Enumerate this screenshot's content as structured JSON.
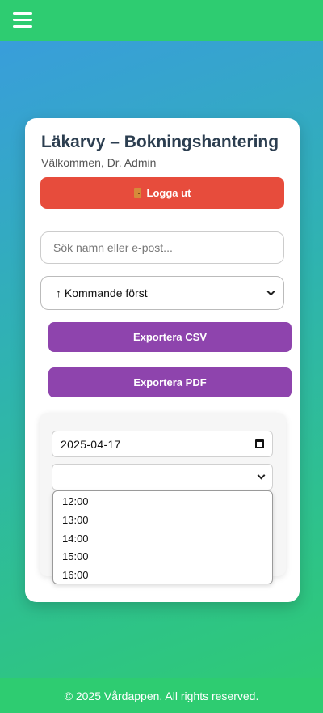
{
  "header": {
    "menu_icon": "hamburger-menu-icon"
  },
  "card": {
    "title": "Läkarvy – Bokningshantering",
    "welcome": "Välkommen, Dr. Admin",
    "logout_label": "Logga ut",
    "logout_icon": "door-icon",
    "search_placeholder": "Sök namn eller e-post...",
    "sort_selected": "↑ Kommande först",
    "export_csv_label": "Exportera CSV",
    "export_pdf_label": "Exportera PDF"
  },
  "booking_form": {
    "date_value": "2025-04-17",
    "time_selected": "",
    "time_options": [
      "12:00",
      "13:00",
      "14:00",
      "15:00",
      "16:00"
    ]
  },
  "footer": {
    "text": "© 2025 Vårdappen. All rights reserved."
  },
  "colors": {
    "primary_green": "#2ecc71",
    "logout_red": "#e74c3c",
    "export_purple": "#8e44ad",
    "title_navy": "#2c3e50"
  }
}
